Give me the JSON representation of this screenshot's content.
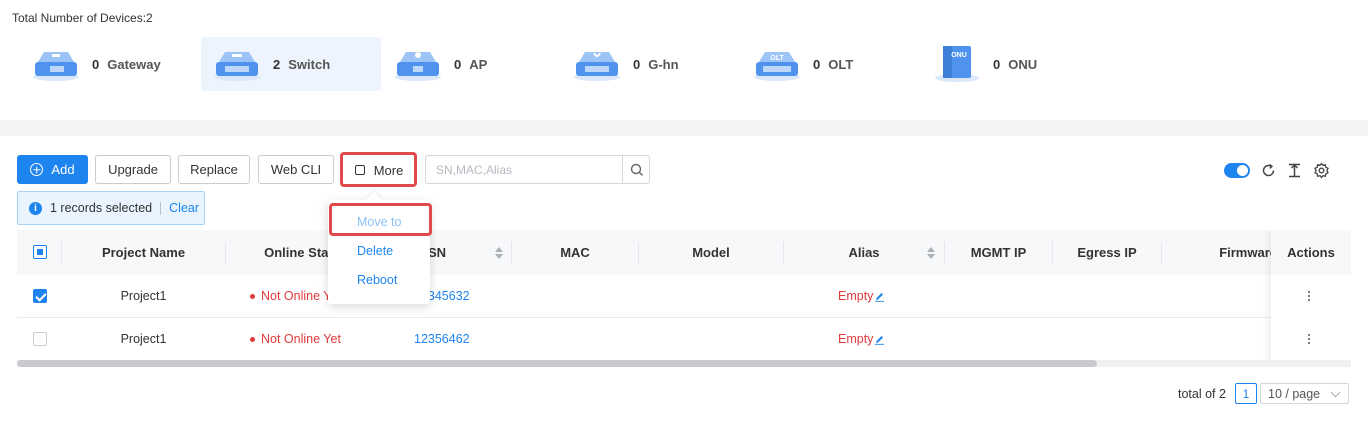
{
  "summary": {
    "title": "Total Number of Devices:2",
    "types": [
      {
        "name": "Gateway",
        "count": "0",
        "icon": "gateway-icon",
        "badge": ""
      },
      {
        "name": "Switch",
        "count": "2",
        "icon": "switch-icon",
        "badge": "",
        "active": true
      },
      {
        "name": "AP",
        "count": "0",
        "icon": "ap-icon",
        "badge": ""
      },
      {
        "name": "G-hn",
        "count": "0",
        "icon": "ghn-icon",
        "badge": ""
      },
      {
        "name": "OLT",
        "count": "0",
        "icon": "olt-icon",
        "badge": "OLT"
      },
      {
        "name": "ONU",
        "count": "0",
        "icon": "onu-icon",
        "badge": "ONU"
      }
    ]
  },
  "toolbar": {
    "add": "Add",
    "upgrade": "Upgrade",
    "replace": "Replace",
    "web_cli": "Web CLI",
    "more": "More",
    "search_placeholder": "SN,MAC,Alias"
  },
  "selection": {
    "text": "1 records selected",
    "clear": "Clear"
  },
  "table": {
    "columns": {
      "project": "Project Name",
      "status": "Online Status",
      "sn": "SN",
      "mac": "MAC",
      "model": "Model",
      "alias": "Alias",
      "mgmt_ip": "MGMT IP",
      "egress_ip": "Egress IP",
      "firmware": "Firmware",
      "actions": "Actions"
    },
    "rows": [
      {
        "checked": true,
        "project": "Project1",
        "status": "Not Online Yet",
        "sn": "12345632",
        "alias": "Empty"
      },
      {
        "checked": false,
        "project": "Project1",
        "status": "Not Online Yet",
        "sn": "12356462",
        "alias": "Empty"
      }
    ]
  },
  "more_menu": {
    "items": [
      "Move to",
      "Delete",
      "Reboot"
    ]
  },
  "pagination": {
    "total": "total of 2",
    "page": "1",
    "page_size": "10 / page"
  },
  "colors": {
    "accent": "#1e84f0",
    "status_offline": "#e03a3a",
    "highlight": "#e04a4a"
  }
}
